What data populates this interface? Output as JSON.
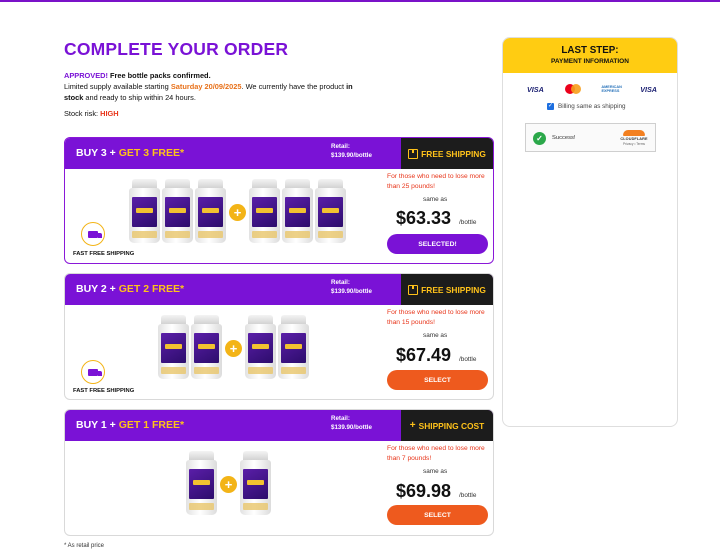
{
  "colors": {
    "primary": "#7a12d6",
    "accent": "#ffc21a",
    "orange": "#ee5a1e",
    "warning": "#e8351a",
    "panel_header": "#ffcc12"
  },
  "page": {
    "title": "COMPLETE YOUR ORDER",
    "approved_label": "APPROVED!",
    "approved_text": " Free bottle packs confirmed.",
    "supply_text": "Limited supply available starting ",
    "supply_date": "Saturday 20/09/2025",
    "stock_pre": ". We currently have the product ",
    "stock_bold": "in stock",
    "stock_post": " and ready to ship within 24 hours.",
    "risk_label": "Stock risk: ",
    "risk_value": "HIGH"
  },
  "packages": [
    {
      "buy": "BUY 3 + ",
      "free": "GET 3 FREE*",
      "retail_label": "Retail:",
      "retail_price": "$139.90/bottle",
      "shipping": "FREE SHIPPING",
      "shipping_icon": "box-icon",
      "pitch": "For those who need to lose more than 25 pounds!",
      "same_as": "same as",
      "price": "$63.33",
      "per": "/bottle",
      "button": "SELECTED!",
      "fast_shipping": "FAST FREE SHIPPING",
      "selected": true,
      "paid_bottles": 3,
      "free_bottles": 3
    },
    {
      "buy": "BUY 2 + ",
      "free": "GET 2 FREE*",
      "retail_label": "Retail:",
      "retail_price": "$139.90/bottle",
      "shipping": "FREE SHIPPING",
      "shipping_icon": "box-icon",
      "pitch": "For those who need to lose more than 15 pounds!",
      "same_as": "same as",
      "price": "$67.49",
      "per": "/bottle",
      "button": "SELECT",
      "fast_shipping": "FAST FREE SHIPPING",
      "selected": false,
      "paid_bottles": 2,
      "free_bottles": 2
    },
    {
      "buy": "BUY 1 + ",
      "free": "GET 1 FREE*",
      "retail_label": "Retail:",
      "retail_price": "$139.90/bottle",
      "shipping": "SHIPPING COST",
      "shipping_icon": "plus-icon",
      "shipping_prefix": "+",
      "pitch": "For those who need to lose more than 7 pounds!",
      "same_as": "same as",
      "price": "$69.98",
      "per": "/bottle",
      "button": "SELECT",
      "selected": false,
      "paid_bottles": 1,
      "free_bottles": 1
    }
  ],
  "footnote": "* As retail price",
  "panel": {
    "title": "LAST STEP:",
    "subtitle": "PAYMENT INFORMATION",
    "cards": [
      "VISA",
      "mastercard",
      "AMERICAN EXPRESS",
      "VISA"
    ],
    "billing_label": "Billing same as shipping",
    "billing_checked": true,
    "captcha_status": "Success!",
    "captcha_brand": "CLOUDFLARE",
    "captcha_links": "Privacy • Terms"
  }
}
